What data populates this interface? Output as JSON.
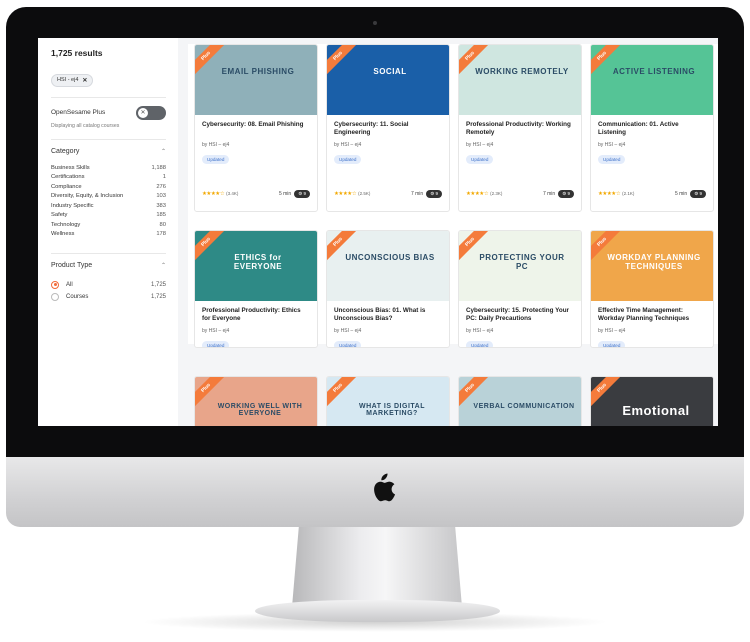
{
  "sidebar": {
    "results_count": "1,725 results",
    "filter_chip": "HSI - ej4",
    "chip_close": "✕",
    "opensesame_label": "OpenSesame Plus",
    "opensesame_sub": "Displaying all catalog courses",
    "toggle_glyph": "✕",
    "category_title": "Category",
    "categories": [
      {
        "label": "Business Skills",
        "count": "1,188"
      },
      {
        "label": "Certifications",
        "count": "1"
      },
      {
        "label": "Compliance",
        "count": "276"
      },
      {
        "label": "Diversity, Equity, & Inclusion",
        "count": "103"
      },
      {
        "label": "Industry Specific",
        "count": "383"
      },
      {
        "label": "Safety",
        "count": "185"
      },
      {
        "label": "Technology",
        "count": "80"
      },
      {
        "label": "Wellness",
        "count": "178"
      }
    ],
    "product_type_title": "Product Type",
    "product_types": [
      {
        "label": "All",
        "count": "1,725",
        "selected": true
      },
      {
        "label": "Courses",
        "count": "1,725",
        "selected": false
      }
    ]
  },
  "cards": [
    {
      "ribbon": "Plus",
      "thumb_text": "EMAIL PHISHING",
      "thumb_bg": "#8fb0b9",
      "title": "Cybersecurity: 08. Email Phishing",
      "by": "by HSI – ej4",
      "badge": "Updated",
      "stars": "★★★★☆",
      "rating_count": "(3.4K)",
      "duration": "5 min",
      "pill": "⚙ 9"
    },
    {
      "ribbon": "Plus",
      "thumb_text": "SOCIAL",
      "thumb_bg": "#1a5fa8",
      "title": "Cybersecurity: 11. Social Engineering",
      "by": "by HSI – ej4",
      "badge": "Updated",
      "stars": "★★★★☆",
      "rating_count": "(2.5K)",
      "duration": "7 min",
      "pill": "⚙ 9"
    },
    {
      "ribbon": "Plus",
      "thumb_text": "WORKING REMOTELY",
      "thumb_bg": "#cfe6e0",
      "title": "Professional Productivity: Working Remotely",
      "by": "by HSI – ej4",
      "badge": "Updated",
      "stars": "★★★★☆",
      "rating_count": "(2.3K)",
      "duration": "7 min",
      "pill": "⚙ 9"
    },
    {
      "ribbon": "Plus",
      "thumb_text": "ACTIVE LISTENING",
      "thumb_bg": "#55c496",
      "title": "Communication: 01. Active Listening",
      "by": "by HSI – ej4",
      "badge": "Updated",
      "stars": "★★★★☆",
      "rating_count": "(2.1K)",
      "duration": "5 min",
      "pill": "⚙ 9"
    },
    {
      "ribbon": "Plus",
      "thumb_text": "ETHICS for EVERYONE",
      "thumb_bg": "#2e8a86",
      "title": "Professional Productivity: Ethics for Everyone",
      "by": "by HSI – ej4",
      "badge": "Updated"
    },
    {
      "ribbon": "Plus",
      "thumb_text": "UNCONSCIOUS BIAS",
      "thumb_bg": "#e8f0f0",
      "title": "Unconscious Bias: 01. What is Unconscious Bias?",
      "by": "by HSI – ej4",
      "badge": "Updated"
    },
    {
      "ribbon": "Plus",
      "thumb_text": "PROTECTING YOUR PC",
      "thumb_bg": "#eef4ea",
      "title": "Cybersecurity: 15. Protecting Your PC: Daily Precautions",
      "by": "by HSI – ej4",
      "badge": "Updated"
    },
    {
      "ribbon": "Plus",
      "thumb_text": "WORKDAY PLANNING TECHNIQUES",
      "thumb_bg": "#f0a64a",
      "title": "Effective Time Management: Workday Planning Techniques",
      "by": "by HSI – ej4",
      "badge": "Updated"
    }
  ],
  "row3": [
    {
      "ribbon": "Plus",
      "thumb_text": "WORKING WELL WITH EVERYONE",
      "thumb_bg": "#e8a58a"
    },
    {
      "ribbon": "Plus",
      "thumb_text": "WHAT IS DIGITAL MARKETING?",
      "thumb_bg": "#d6e8f2"
    },
    {
      "ribbon": "Plus",
      "thumb_text": "VERBAL COMMUNICATION",
      "thumb_bg": "#b9d2d8"
    },
    {
      "ribbon": "Plus",
      "thumb_text": "Emotional",
      "thumb_bg": "#3a3c40"
    }
  ]
}
